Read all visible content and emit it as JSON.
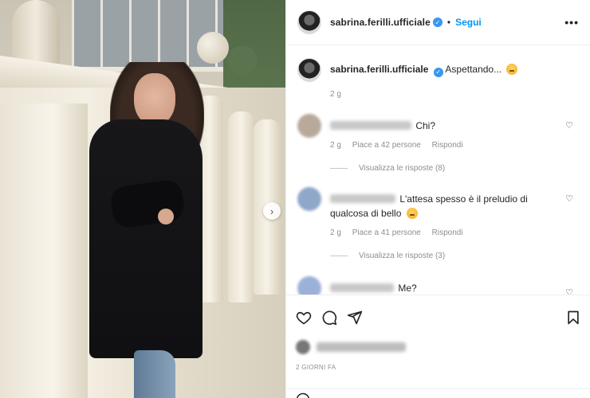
{
  "post": {
    "username": "sabrina.ferilli.ufficiale",
    "separator": "•",
    "follow_label": "Segui",
    "more_label": "•••",
    "next_label": "›"
  },
  "caption": {
    "username": "sabrina.ferilli.ufficiale",
    "text": "Aspettando...",
    "time": "2 g"
  },
  "comments": [
    {
      "text": "Chi?",
      "time": "2 g",
      "likes": "Piace a 42 persone",
      "reply": "Rispondi",
      "view_replies": "Visualizza le risposte (8)",
      "avatar_color": "#b9a99a"
    },
    {
      "text": "L'attesa spesso è il preludio di qualcosa di bello",
      "time": "2 g",
      "likes": "Piace a 41 persone",
      "reply": "Rispondi",
      "view_replies": "Visualizza le risposte (3)",
      "avatar_color": "#8fa7c9"
    },
    {
      "text": "Me?",
      "avatar_color": "#9cb1d8"
    }
  ],
  "actions": {
    "date": "2 GIORNI FA"
  },
  "colors": {
    "accent": "#0095f6",
    "verified": "#3897f0",
    "muted": "#8e8e8e"
  }
}
